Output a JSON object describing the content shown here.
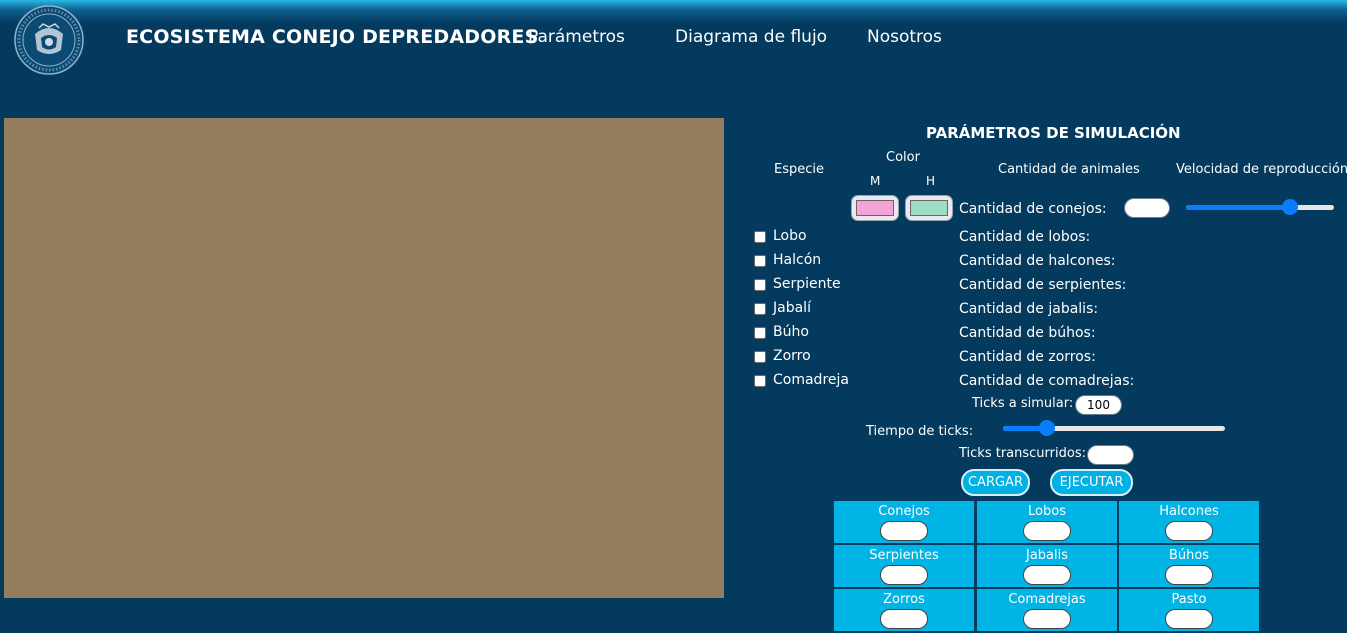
{
  "header": {
    "brand": "ECOSISTEMA CONEJO DEPREDADORES",
    "nav": [
      "Parámetros",
      "Diagrama de flujo",
      "Nosotros"
    ]
  },
  "panel": {
    "title": "PARÁMETROS DE SIMULACIÓN",
    "col_species": "Especie",
    "col_color": "Color",
    "color_m": "M",
    "color_h": "H",
    "col_amount": "Cantidad de animales",
    "col_speed": "Velocidad de reproducción",
    "swatch_m_color": "#f4a3d8",
    "swatch_h_color": "#9ddcc5",
    "rabbits_label": "Cantidad de conejos:",
    "rabbits_value": "",
    "reproduction_speed": 0.7,
    "species": [
      {
        "name": "Lobo",
        "checked": false,
        "amount_label": "Cantidad de lobos:"
      },
      {
        "name": "Halcón",
        "checked": false,
        "amount_label": "Cantidad de halcones:"
      },
      {
        "name": "Serpiente",
        "checked": false,
        "amount_label": "Cantidad de serpientes:"
      },
      {
        "name": "Jabalí",
        "checked": false,
        "amount_label": "Cantidad de jabalis:"
      },
      {
        "name": "Búho",
        "checked": false,
        "amount_label": "Cantidad de búhos:"
      },
      {
        "name": "Zorro",
        "checked": false,
        "amount_label": "Cantidad de zorros:"
      },
      {
        "name": "Comadreja",
        "checked": false,
        "amount_label": "Cantidad de comadrejas:"
      }
    ],
    "ticks_label": "Ticks a simular:",
    "ticks_value": "100",
    "tick_time_label": "Tiempo de ticks:",
    "tick_time": 0.2,
    "elapsed_label": "Ticks transcurridos:",
    "elapsed_value": "",
    "load_button": "CARGAR",
    "run_button": "EJECUTAR"
  },
  "counts": [
    {
      "name": "Conejos",
      "value": ""
    },
    {
      "name": "Lobos",
      "value": ""
    },
    {
      "name": "Halcones",
      "value": ""
    },
    {
      "name": "Serpientes",
      "value": ""
    },
    {
      "name": "Jabalis",
      "value": ""
    },
    {
      "name": "Búhos",
      "value": ""
    },
    {
      "name": "Zorros",
      "value": ""
    },
    {
      "name": "Comadrejas",
      "value": ""
    },
    {
      "name": "Pasto",
      "value": ""
    }
  ],
  "icons": {
    "logo": "university-seal-icon"
  },
  "colors": {
    "background": "#043a5e",
    "canvas": "#927e5c",
    "accent": "#00b4e6",
    "slider": "#0a7dff"
  }
}
